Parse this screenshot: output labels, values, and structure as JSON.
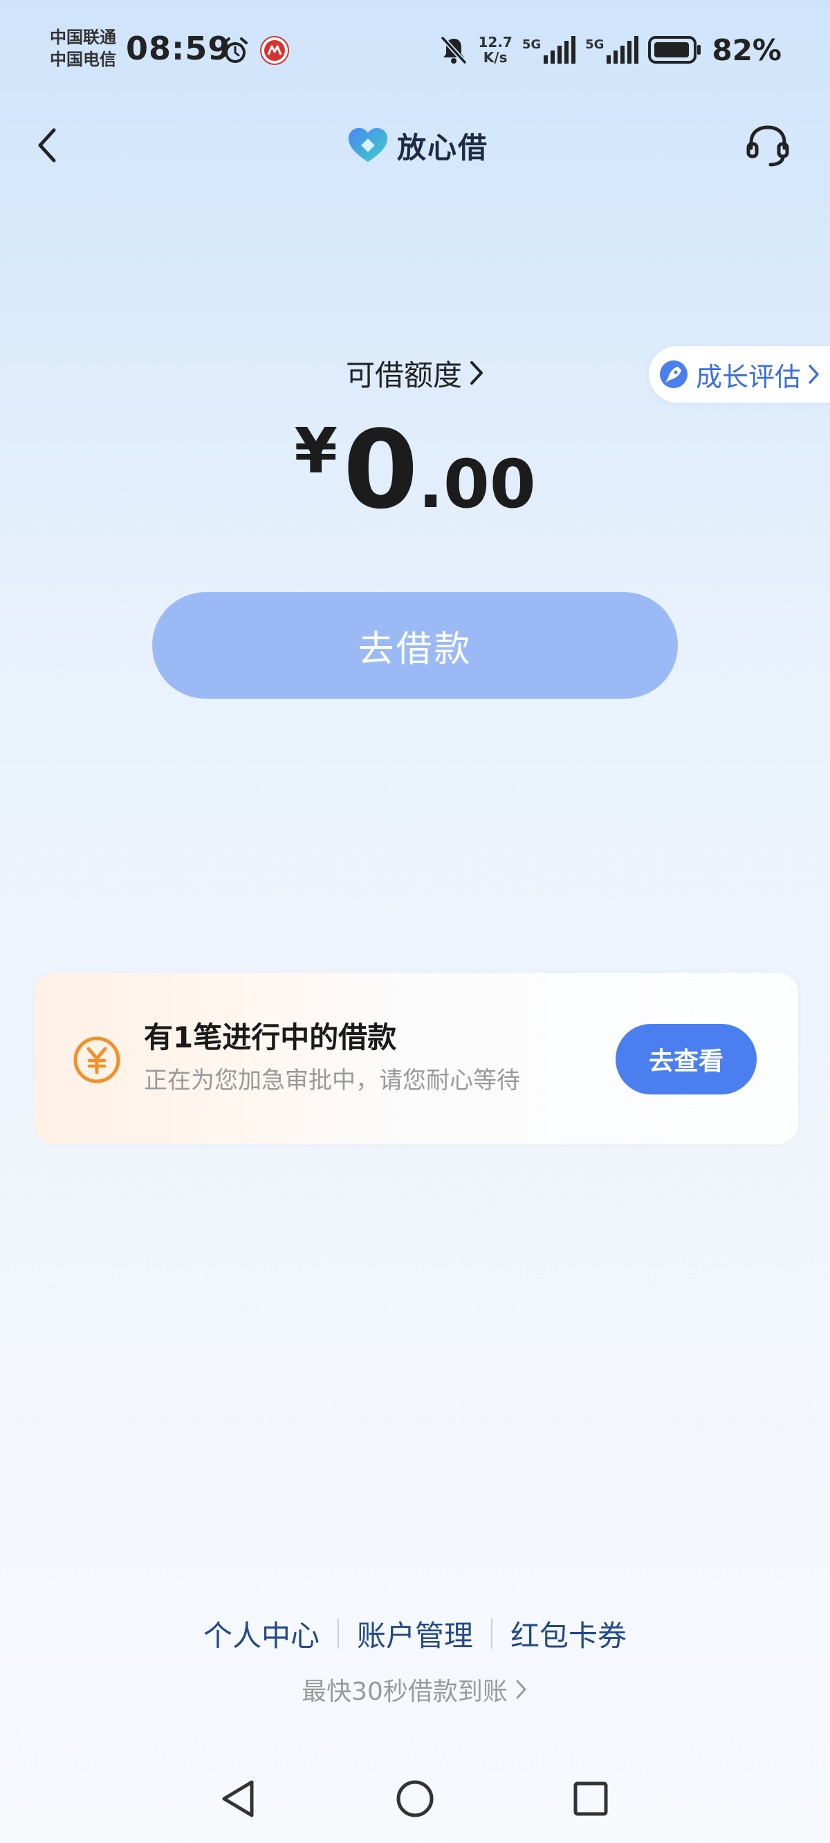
{
  "status_bar": {
    "carrier_1": "中国联通",
    "carrier_2": "中国电信",
    "time": "08:59",
    "net_speed_value": "12.7",
    "net_speed_unit": "K/s",
    "signal_1_label": "5G",
    "signal_2_label": "5G",
    "battery": "82%"
  },
  "header": {
    "app_name": "放心借",
    "back_icon": "chevron-left-icon",
    "service_icon": "headset-icon"
  },
  "credit": {
    "label": "可借额度",
    "currency": "¥",
    "amount_int": "0",
    "amount_dec": ".00",
    "growth_badge": "成长评估",
    "borrow_button": "去借款"
  },
  "loan_card": {
    "title": "有1笔进行中的借款",
    "subtitle": "正在为您加急审批中，请您耐心等待",
    "button": "去查看",
    "icon": "yuan-coin-icon"
  },
  "footer": {
    "links": [
      "个人中心",
      "账户管理",
      "红包卡券"
    ],
    "tagline": "最快30秒借款到账"
  },
  "colors": {
    "primary": "#4b7ff0",
    "primary_disabled": "#9bbaf5",
    "accent_orange": "#f0902a",
    "link_navy": "#234a86"
  }
}
